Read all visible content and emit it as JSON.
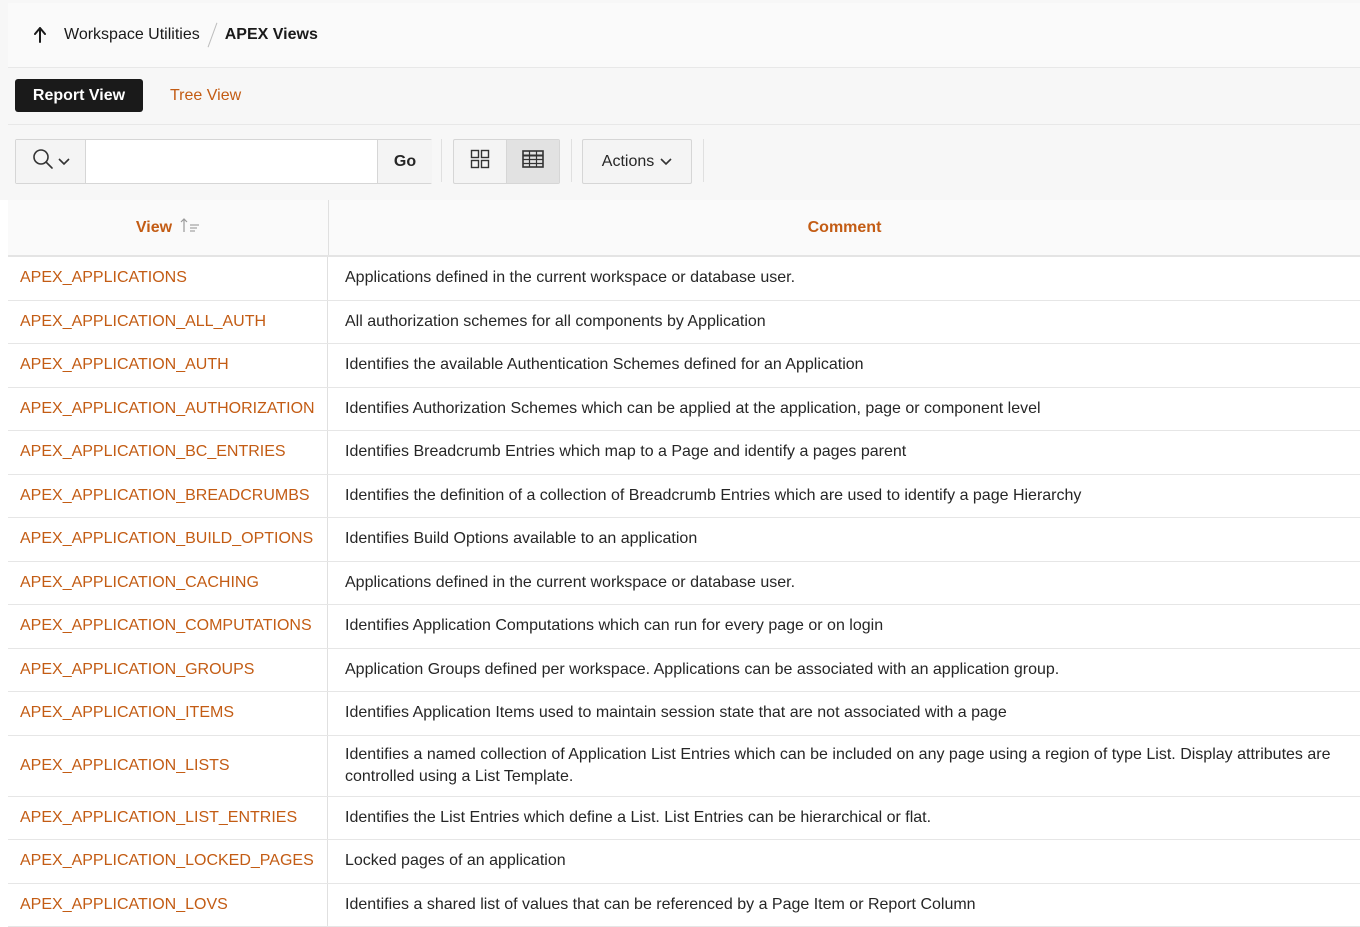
{
  "breadcrumb": {
    "parent": "Workspace Utilities",
    "current": "APEX Views"
  },
  "view_switch": {
    "report_view": "Report View",
    "tree_view": "Tree View"
  },
  "toolbar": {
    "search_value": "",
    "go_label": "Go",
    "actions_label": "Actions"
  },
  "table": {
    "headers": {
      "view": "View",
      "comment": "Comment"
    },
    "rows": [
      {
        "view": "APEX_APPLICATIONS",
        "comment": "Applications defined in the current workspace or database user."
      },
      {
        "view": "APEX_APPLICATION_ALL_AUTH",
        "comment": "All authorization schemes for all components by Application"
      },
      {
        "view": "APEX_APPLICATION_AUTH",
        "comment": "Identifies the available Authentication Schemes defined for an Application"
      },
      {
        "view": "APEX_APPLICATION_AUTHORIZATION",
        "comment": "Identifies Authorization Schemes which can be applied at the application, page or component level"
      },
      {
        "view": "APEX_APPLICATION_BC_ENTRIES",
        "comment": "Identifies Breadcrumb Entries which map to a Page and identify a pages parent"
      },
      {
        "view": "APEX_APPLICATION_BREADCRUMBS",
        "comment": "Identifies the definition of a collection of Breadcrumb Entries which are used to identify a page Hierarchy"
      },
      {
        "view": "APEX_APPLICATION_BUILD_OPTIONS",
        "comment": "Identifies Build Options available to an application"
      },
      {
        "view": "APEX_APPLICATION_CACHING",
        "comment": "Applications defined in the current workspace or database user."
      },
      {
        "view": "APEX_APPLICATION_COMPUTATIONS",
        "comment": "Identifies Application Computations which can run for every page or on login"
      },
      {
        "view": "APEX_APPLICATION_GROUPS",
        "comment": "Application Groups defined per workspace. Applications can be associated with an application group."
      },
      {
        "view": "APEX_APPLICATION_ITEMS",
        "comment": "Identifies Application Items used to maintain session state that are not associated with a page"
      },
      {
        "view": "APEX_APPLICATION_LISTS",
        "comment": "Identifies a named collection of Application List Entries which can be included on any page using a region of type List. Display attributes are controlled using a List Template."
      },
      {
        "view": "APEX_APPLICATION_LIST_ENTRIES",
        "comment": "Identifies the List Entries which define a List. List Entries can be hierarchical or flat."
      },
      {
        "view": "APEX_APPLICATION_LOCKED_PAGES",
        "comment": "Locked pages of an application"
      },
      {
        "view": "APEX_APPLICATION_LOVS",
        "comment": "Identifies a shared list of values that can be referenced by a Page Item or Report Column"
      }
    ]
  }
}
